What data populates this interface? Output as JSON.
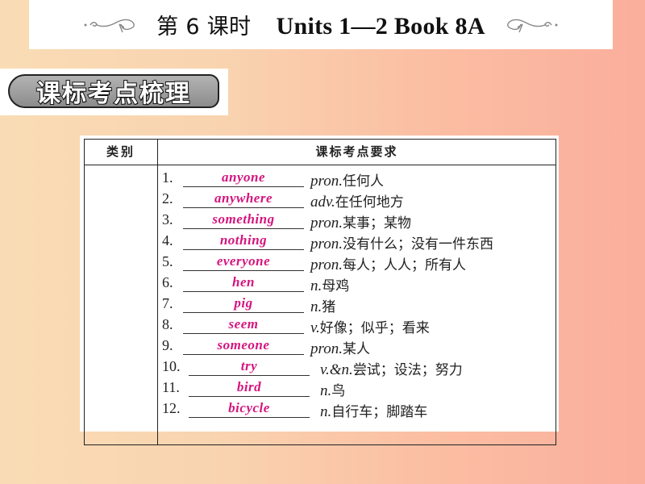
{
  "header": {
    "lesson": "第 6 课时",
    "title": "Units 1—2 Book 8A"
  },
  "section_badge": "课标考点梳理",
  "table": {
    "columns": [
      "类别",
      "课标考点要求"
    ],
    "rows": [
      {
        "num": "1.",
        "answer": "anyone",
        "pos": "pron.",
        "meaning": "任何人"
      },
      {
        "num": "2.",
        "answer": "anywhere",
        "pos": "adv.",
        "meaning": "在任何地方"
      },
      {
        "num": "3.",
        "answer": "something",
        "pos": "pron.",
        "meaning": "某事；某物"
      },
      {
        "num": "4.",
        "answer": "nothing",
        "pos": "pron.",
        "meaning": "没有什么；没有一件东西"
      },
      {
        "num": "5.",
        "answer": "everyone",
        "pos": "pron.",
        "meaning": "每人；人人；所有人"
      },
      {
        "num": "6.",
        "answer": "hen",
        "pos": "n.",
        "meaning": "母鸡"
      },
      {
        "num": "7.",
        "answer": "pig",
        "pos": "n.",
        "meaning": "猪"
      },
      {
        "num": "8.",
        "answer": "seem",
        "pos": "v.",
        "meaning": "好像；似乎；看来"
      },
      {
        "num": "9.",
        "answer": "someone",
        "pos": "pron.",
        "meaning": "某人"
      },
      {
        "num": "10.",
        "answer": "try",
        "pos": "v.&n.",
        "meaning": "尝试；设法；努力"
      },
      {
        "num": "11.",
        "answer": "bird",
        "pos": "n.",
        "meaning": "鸟"
      },
      {
        "num": "12.",
        "answer": "bicycle",
        "pos": "n.",
        "meaning": "自行车；脚踏车"
      }
    ]
  },
  "colors": {
    "answer": "#d4157e",
    "background_left": "#f9dcb5",
    "background_right": "#faae9c"
  }
}
